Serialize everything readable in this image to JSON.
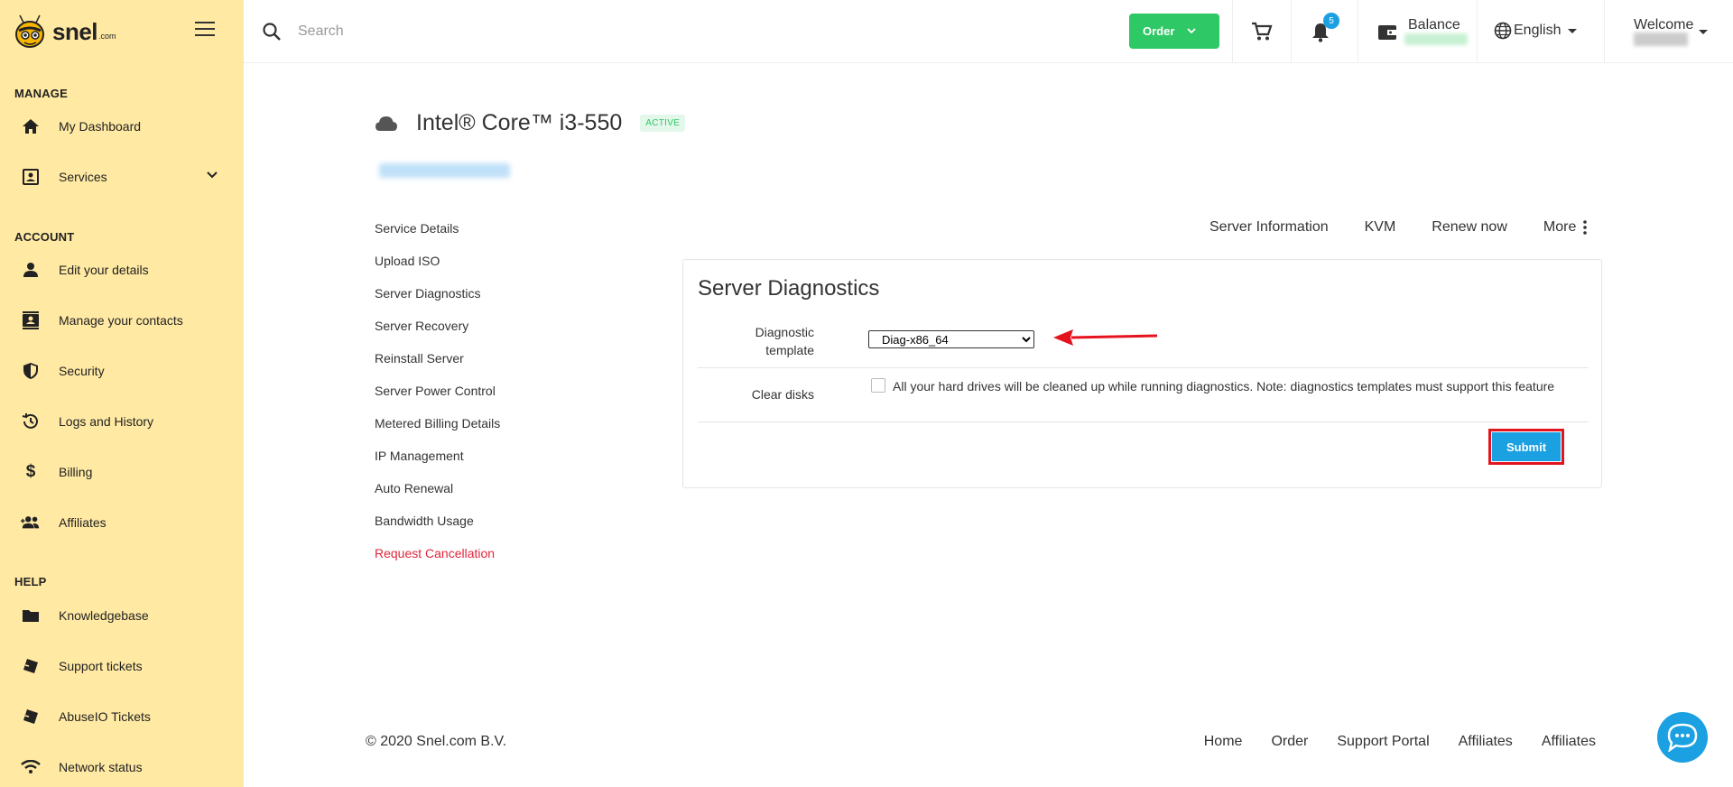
{
  "brand": {
    "name": "snel",
    "suffix": ".com"
  },
  "sidebar": {
    "sections": [
      {
        "title": "MANAGE"
      },
      {
        "title": "ACCOUNT"
      },
      {
        "title": "HELP"
      }
    ],
    "items": [
      {
        "label": "My Dashboard",
        "icon": "home-icon"
      },
      {
        "label": "Services",
        "icon": "services-icon"
      },
      {
        "label": "Edit your details",
        "icon": "person-icon"
      },
      {
        "label": "Manage your contacts",
        "icon": "contacts-icon"
      },
      {
        "label": "Security",
        "icon": "shield-icon"
      },
      {
        "label": "Logs and History",
        "icon": "history-icon"
      },
      {
        "label": "Billing",
        "icon": "dollar-icon"
      },
      {
        "label": "Affiliates",
        "icon": "group-icon"
      },
      {
        "label": "Knowledgebase",
        "icon": "folder-icon"
      },
      {
        "label": "Support tickets",
        "icon": "ticket-icon"
      },
      {
        "label": "AbuseIO Tickets",
        "icon": "ticket-icon"
      },
      {
        "label": "Network status",
        "icon": "wifi-icon"
      }
    ]
  },
  "topbar": {
    "search_placeholder": "Search",
    "order_label": "Order",
    "notifications_count": "5",
    "balance_label": "Balance",
    "language": "English",
    "welcome_label": "Welcome"
  },
  "service": {
    "title": "Intel® Core™ i3-550",
    "status": "ACTIVE"
  },
  "service_nav": [
    "Service Details",
    "Upload ISO",
    "Server Diagnostics",
    "Server Recovery",
    "Reinstall Server",
    "Server Power Control",
    "Metered Billing Details",
    "IP Management",
    "Auto Renewal",
    "Bandwidth Usage",
    "Request Cancellation"
  ],
  "tabs": [
    "Server Information",
    "KVM",
    "Renew now",
    "More"
  ],
  "diagnostics": {
    "heading": "Server Diagnostics",
    "template_label_line1": "Diagnostic",
    "template_label_line2": "template",
    "template_value": "Diag-x86_64",
    "clear_disks_label": "Clear disks",
    "clear_disks_text": "All your hard drives will be cleaned up while running diagnostics. Note: diagnostics templates must support this feature",
    "clear_disks_checked": false,
    "submit_label": "Submit"
  },
  "footer": {
    "copyright": "© 2020 Snel.com B.V.",
    "links": [
      "Home",
      "Order",
      "Support Portal",
      "Affiliates",
      "Affiliates"
    ]
  },
  "colors": {
    "sidebar_bg": "#ffe9a3",
    "order_green": "#2ec866",
    "primary_blue": "#1ba0e2",
    "cancel_red": "#e0263b",
    "highlight_red": "#e4141f"
  }
}
